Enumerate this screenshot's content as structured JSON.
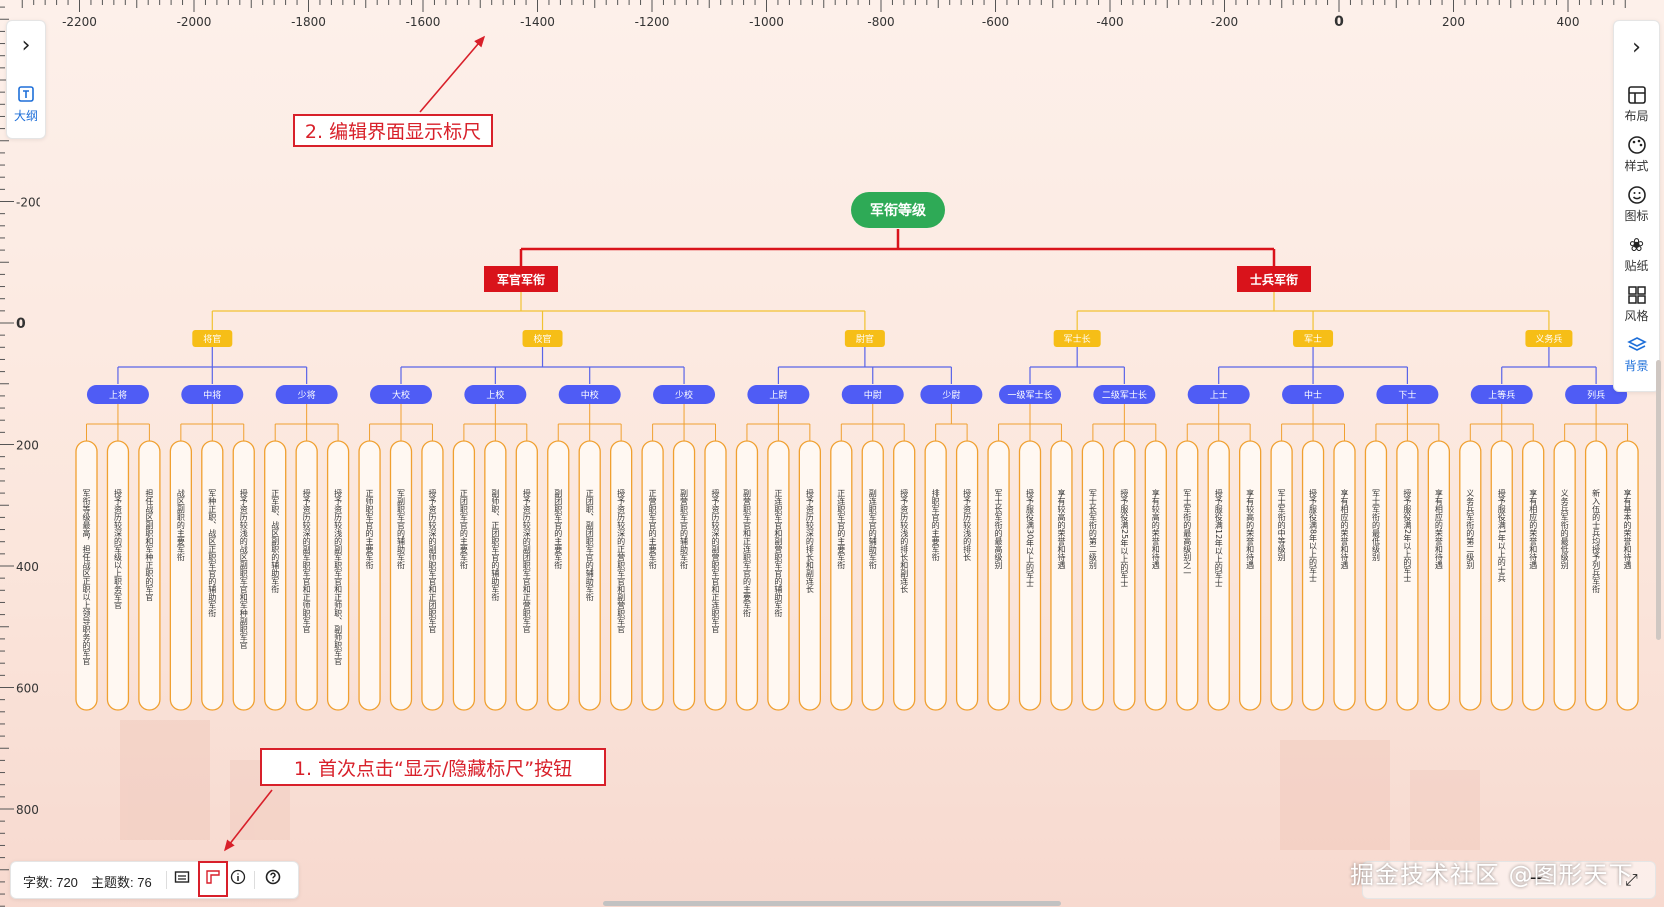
{
  "ruler_top": [
    "-2200",
    "-2000",
    "-1800",
    "-1600",
    "-1400",
    "-1200",
    "-1000",
    "-800",
    "-600",
    "-400",
    "-200",
    "0",
    "200",
    "400"
  ],
  "ruler_left": [
    "-200",
    "0",
    "200",
    "400",
    "600",
    "800"
  ],
  "left_panel": {
    "outline_label": "大纲"
  },
  "right_panel": {
    "items": [
      {
        "label": "布局",
        "icon": "layout-icon"
      },
      {
        "label": "样式",
        "icon": "palette-icon"
      },
      {
        "label": "图标",
        "icon": "smiley-icon"
      },
      {
        "label": "贴纸",
        "icon": "sticker-icon"
      },
      {
        "label": "风格",
        "icon": "grid-icon"
      },
      {
        "label": "背景",
        "icon": "layers-icon"
      }
    ]
  },
  "status": {
    "char_count": "字数: 720",
    "topic_count": "主题数: 76"
  },
  "callouts": {
    "step1": "1. 首次点击“显示/隐藏标尺”按钮",
    "step2": "2. 编辑界面显示标尺"
  },
  "watermark": "掘金技术社区 @图形天下",
  "colors": {
    "root": "#2eaa56",
    "level1": "#d9131b",
    "level2": "#f6be17",
    "level3": "#4f5cf5",
    "leafBorder": "#f0a030",
    "line1": "#d9131b",
    "line2": "#f1c232",
    "line3": "#5a64e8"
  },
  "mindmap": {
    "root": "军衔等级",
    "groups": [
      {
        "label": "军官军衔",
        "categories": [
          {
            "label": "将官",
            "ranks": [
              {
                "label": "上将",
                "notes": [
                  "军衔等级最高，担任战区正职以上领导职务的军官",
                  "授予资历较深的军级以上职务军官",
                  "担任战区副职和军种正职的军官"
                ]
              },
              {
                "label": "中将",
                "notes": [
                  "战区副职的主要军衔",
                  "军种正职、战区正职军官的辅助军衔",
                  "授予资历较浅的战区副职军官和军种副职军官"
                ]
              },
              {
                "label": "少将",
                "notes": [
                  "正军职、战区副职的辅助军衔",
                  "授予资历较深的副军职军官和正师职军官",
                  "授予资历较浅的副军职军官和正师职、副师职军官"
                ]
              }
            ]
          },
          {
            "label": "校官",
            "ranks": [
              {
                "label": "大校",
                "notes": [
                  "正师职军官的主要军衔",
                  "军副职军官的辅助军衔",
                  "授予资历较深的副师职军官和正团职军官"
                ]
              },
              {
                "label": "上校",
                "notes": [
                  "正团职军官的主要军衔",
                  "副师职、正团职军官的辅助军衔",
                  "授予资历较深的副团职军官和正营职军官"
                ]
              },
              {
                "label": "中校",
                "notes": [
                  "副团职军官的主要军衔",
                  "正团职、副团职军官的辅助军衔",
                  "授予资历较深的正营职军官和副营职军官"
                ]
              },
              {
                "label": "少校",
                "notes": [
                  "正营职军官的主要军衔",
                  "副营职军官的辅助军衔",
                  "授予资历较深的副营职军官和正连职军官"
                ]
              }
            ]
          },
          {
            "label": "尉官",
            "ranks": [
              {
                "label": "上尉",
                "notes": [
                  "副营职军官和正连职军官的主要军衔",
                  "正连职军官和副营职军官的辅助军衔",
                  "授予资历较深的排长和副连长"
                ]
              },
              {
                "label": "中尉",
                "notes": [
                  "正连职军官的主要军衔",
                  "副连职军官的辅助军衔",
                  "授予资历较浅的排长和副连长"
                ]
              },
              {
                "label": "少尉",
                "notes": [
                  "排职军官的主要军衔",
                  "授予资历较浅的排长"
                ]
              }
            ]
          }
        ]
      },
      {
        "label": "士兵军衔",
        "categories": [
          {
            "label": "军士长",
            "ranks": [
              {
                "label": "一级军士长",
                "notes": [
                  "军士长军衔的最高级别",
                  "授予服役满30年以上的军士",
                  "享有较高的荣誉和待遇"
                ]
              },
              {
                "label": "二级军士长",
                "notes": [
                  "军士长军衔的第二级别",
                  "授予服役满25年以上的军士",
                  "享有较高的荣誉和待遇"
                ]
              }
            ]
          },
          {
            "label": "军士",
            "ranks": [
              {
                "label": "上士",
                "notes": [
                  "军士军衔的最高级别之一",
                  "授予服役满12年以上的军士",
                  "享有较高的荣誉和待遇"
                ]
              },
              {
                "label": "中士",
                "notes": [
                  "军士军衔的中等级别",
                  "授予服役满8年以上的军士",
                  "享有相应的荣誉和待遇"
                ]
              },
              {
                "label": "下士",
                "notes": [
                  "军士军衔的最低级别",
                  "授予服役满2年以上的军士",
                  "享有相应的荣誉和待遇"
                ]
              }
            ]
          },
          {
            "label": "义务兵",
            "ranks": [
              {
                "label": "上等兵",
                "notes": [
                  "义务兵军衔的第二级别",
                  "授予服役满1年以上的士兵",
                  "享有相应的荣誉和待遇"
                ]
              },
              {
                "label": "列兵",
                "notes": [
                  "义务兵军衔的最低级别",
                  "新入伍的士兵均授予列兵军衔",
                  "享有基本的荣誉和待遇"
                ]
              }
            ]
          }
        ]
      }
    ]
  }
}
